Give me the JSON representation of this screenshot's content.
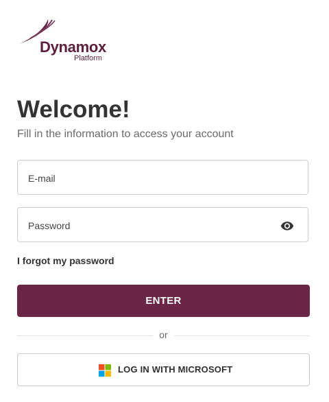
{
  "brand": {
    "name": "Dynamox",
    "subtitle": "Platform",
    "color": "#5e1f3c",
    "logo_icon": "swoosh-icon"
  },
  "heading": {
    "title": "Welcome!",
    "subtitle": "Fill in the information to access your account"
  },
  "form": {
    "email_placeholder": "E-mail",
    "password_placeholder": "Password",
    "visibility_icon": "eye-icon",
    "forgot_label": "I forgot my password",
    "submit_label": "ENTER",
    "submit_color": "#6b2545"
  },
  "divider": {
    "label": "or"
  },
  "sso": {
    "microsoft_label": "LOG IN WITH MICROSOFT",
    "icon": "microsoft-logo-icon"
  }
}
